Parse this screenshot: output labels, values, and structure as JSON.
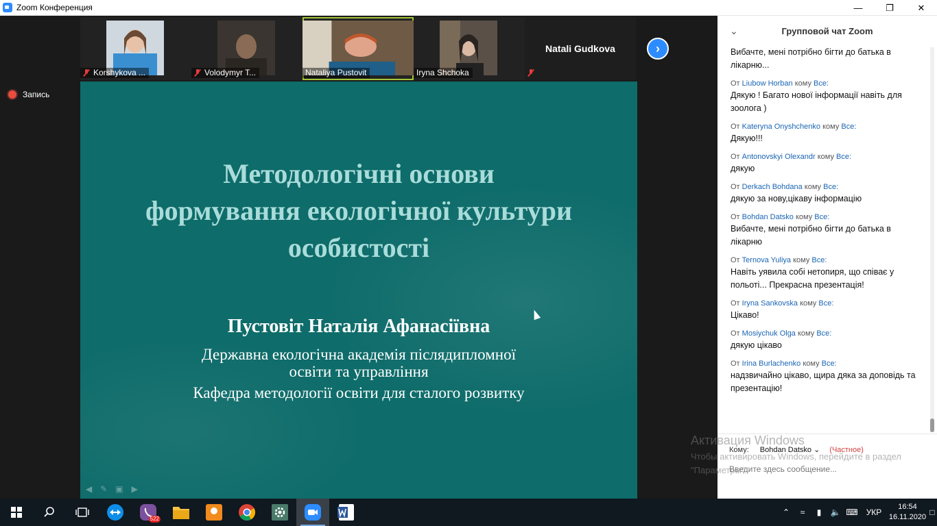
{
  "window": {
    "title": "Zoom Конференция"
  },
  "participants": [
    {
      "name": "Korshykova ...",
      "muted": true
    },
    {
      "name": "Volodymyr T...",
      "muted": true
    },
    {
      "name": "Nataliya Pustovit",
      "muted": false,
      "active": true
    },
    {
      "name": "Iryna Shchoka",
      "muted": false
    },
    {
      "name": "Natali Gudkova",
      "muted": true,
      "video": false
    }
  ],
  "recording": {
    "label": "Запись"
  },
  "slide": {
    "title_lines": [
      "Методологічні основи",
      "формування екологічної культури",
      "особистості"
    ],
    "author": "Пустовіт Наталія Афанасіївна",
    "institution_lines": [
      "Державна екологічна академія післядипломної",
      "освіти та управління"
    ],
    "department": "Кафедра методології освіти для сталого розвитку"
  },
  "chat": {
    "title": "Групповой чат Zoom",
    "from_word": "От",
    "to_word": "кому",
    "all_word": "Все:",
    "first_text": "Вибачте, мені потрібно бігти до батька в лікарню...",
    "messages": [
      {
        "sender": "Liubow Horban",
        "text": "Дякую ! Багато нової інформації навіть для зоолога )"
      },
      {
        "sender": "Kateryna Onyshchenko",
        "text": "Дякую!!!"
      },
      {
        "sender": "Antonovskyi Olexandr",
        "text": "дякую"
      },
      {
        "sender": "Derkach Bohdana",
        "text": "дякую за нову,цікаву інформацію"
      },
      {
        "sender": "Bohdan Datsko",
        "text": "Вибачте, мені потрібно бігти до батька в лікарню"
      },
      {
        "sender": "Ternova Yuliya",
        "text": "Навіть уявила собі нетопиря, що співає у польоті... Прекрасна презентація!"
      },
      {
        "sender": "Iryna Sankovska",
        "text": "Цікаво!"
      },
      {
        "sender": "Mosiychuk Olga",
        "text": "дякую цікаво"
      },
      {
        "sender": "Irina Burlachenko",
        "text": "надзвичайно цікаво, щира дяка за доповідь та презентацію!"
      }
    ],
    "to_label": "Кому:",
    "to_value": "Bohdan Datsko",
    "private_label": "(Частное)",
    "input_placeholder": "Введите здесь сообщение..."
  },
  "watermark": {
    "line1": "Активация Windows",
    "line2": "Чтобы активировать Windows, перейдите в раздел \"Параметры\"."
  },
  "taskbar": {
    "viber_badge": "522",
    "lang": "УКР",
    "time": "16:54",
    "date": "16.11.2020"
  }
}
